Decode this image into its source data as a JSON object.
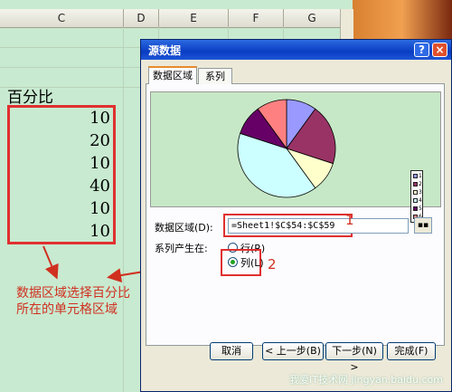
{
  "sheet": {
    "columns": [
      "C",
      "D",
      "E",
      "F",
      "G"
    ],
    "header_label": "百分比",
    "values": [
      "10",
      "20",
      "10",
      "40",
      "10",
      "10"
    ],
    "annotation_line1": "数据区域选择百分比",
    "annotation_line2": "所在的单元格区域"
  },
  "dialog": {
    "title": "源数据",
    "tabs": [
      "数据区域",
      "系列"
    ],
    "active_tab": "数据区域",
    "range_label": "数据区域(D):",
    "range_value": "=Sheet1!$C$54:$C$59",
    "series_label": "系列产生在:",
    "radio_row": "行(R)",
    "radio_col": "列(L)",
    "radio_selected": "列(L)",
    "buttons": [
      "取消",
      "< 上一步(B)",
      "下一步(N) >",
      "完成(F)"
    ],
    "help_glyph": "?",
    "close_glyph": "×",
    "collapse_glyph": "▪▪",
    "marker1": "1",
    "marker2": "2"
  },
  "chart_data": {
    "type": "pie",
    "categories": [
      "1",
      "2",
      "3",
      "4",
      "5",
      "6"
    ],
    "values": [
      10,
      20,
      10,
      40,
      10,
      10
    ],
    "colors": [
      "#9999ff",
      "#993366",
      "#ffffcc",
      "#ccffff",
      "#660066",
      "#ff8080"
    ]
  },
  "watermark": "我爱IT技术网 jingyan.baidu.com"
}
